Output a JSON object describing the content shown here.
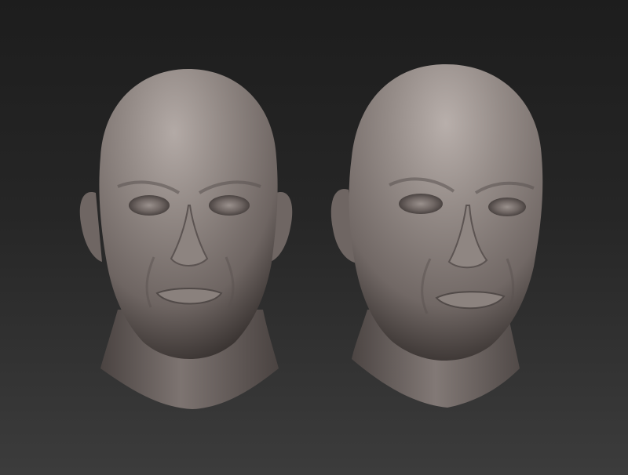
{
  "scene": {
    "background_top": "#1d1d1d",
    "background_bottom": "#3c3c3c",
    "material_base": "#817774",
    "material_highlight": "#b3aaa6",
    "material_shadow": "#3a3432",
    "models": [
      {
        "name": "head-sculpt-front",
        "view": "front"
      },
      {
        "name": "head-sculpt-three-quarter",
        "view": "three-quarter"
      }
    ]
  }
}
